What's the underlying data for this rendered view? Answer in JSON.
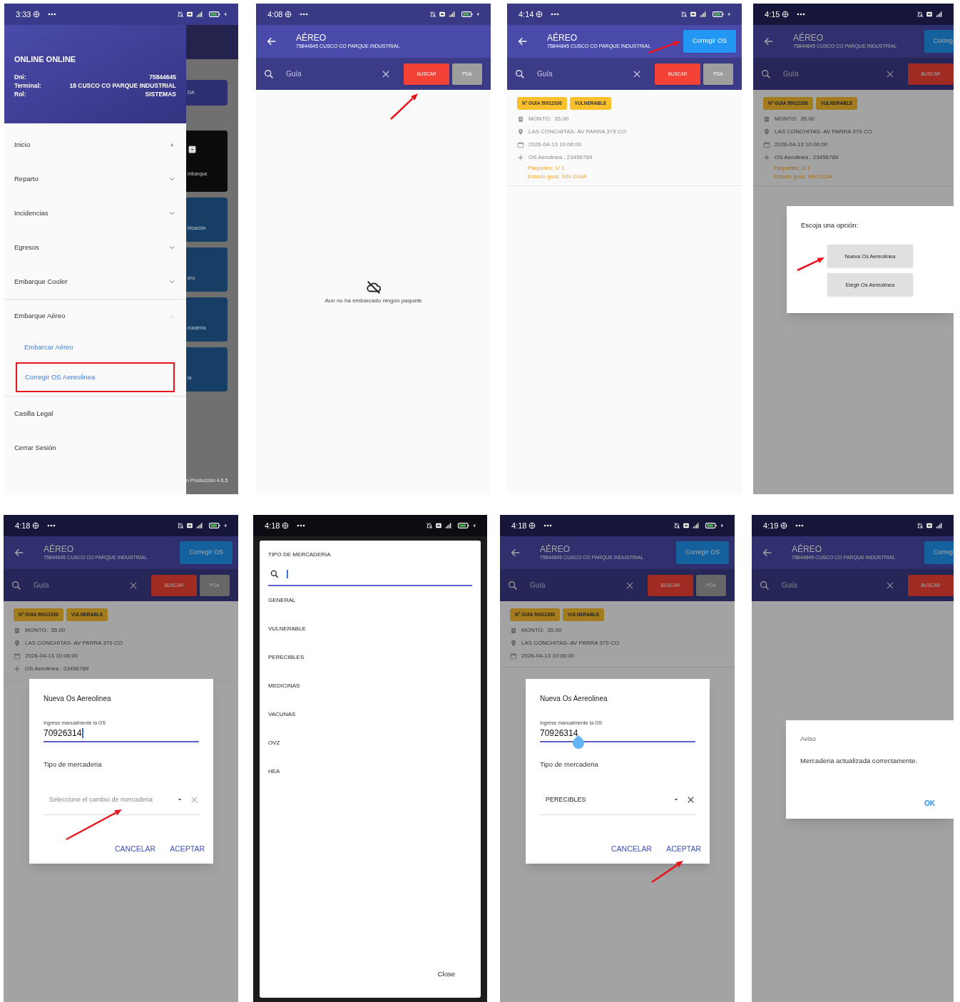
{
  "screens": [
    {
      "kind": "drawer",
      "time": "3:33",
      "profile": {
        "name": "ONLINE ONLINE",
        "fields": [
          {
            "label": "Dni:",
            "value": "75844645"
          },
          {
            "label": "Terminal:",
            "value": "18 CUSCO CO PARQUE INDUSTRIAL"
          },
          {
            "label": "Rol:",
            "value": "SISTEMAS"
          }
        ]
      },
      "menu": [
        {
          "label": "Inicio",
          "kind": "link"
        },
        {
          "label": "Reparto",
          "kind": "group",
          "expanded": false
        },
        {
          "label": "Incidencias",
          "kind": "group",
          "expanded": false
        },
        {
          "label": "Egresos",
          "kind": "group",
          "expanded": false
        },
        {
          "label": "Embarque Cooler",
          "kind": "group",
          "expanded": false
        },
        {
          "label": "Embarque Aéreo",
          "kind": "group",
          "expanded": true,
          "children": [
            {
              "label": "Embarcar Aéreo"
            },
            {
              "label": "Corregir OS Aereolinea",
              "highlighted": true
            }
          ]
        },
        {
          "label": "Casilla Legal",
          "kind": "plain"
        },
        {
          "label": "Cerrar Sesión",
          "kind": "plain"
        }
      ],
      "background_tiles": [
        {
          "kind": "bar",
          "label": "DA",
          "color": "#2e2f72"
        },
        {
          "kind": "icon",
          "label": "mbarque",
          "color": "#0b0b0b"
        },
        {
          "kind": "plain",
          "label": "bicación",
          "color": "#173f66"
        },
        {
          "kind": "plain",
          "label": "ero",
          "color": "#173f66"
        },
        {
          "kind": "plain",
          "label": "rcaderia",
          "color": "#173f66"
        },
        {
          "kind": "plain",
          "label": "ia",
          "color": "#173f66"
        }
      ],
      "version": "n Producción 4.6.5"
    },
    {
      "kind": "list",
      "time": "4:08",
      "header": {
        "title": "AÉREO",
        "subtitle": "75844645 CUSCO CO PARQUE INDUSTRIAL"
      },
      "search": {
        "placeholder": "Guía",
        "buttons": [
          {
            "label": "BUSCAR",
            "kind": "primary",
            "pointer": true
          },
          {
            "label": "PDA",
            "kind": "secondary"
          }
        ]
      },
      "empty_message": "Aun no ha embarcado ningún paquete"
    },
    {
      "kind": "list",
      "time": "4:14",
      "header": {
        "title": "AÉREO",
        "subtitle": "75844645 CUSCO CO PARQUE INDUSTRIAL",
        "action": {
          "label": "Corregir OS",
          "pointer": true
        }
      },
      "search": {
        "placeholder": "Guía",
        "buttons": [
          {
            "label": "BUSCAR",
            "kind": "primary"
          },
          {
            "label": "PDA",
            "kind": "secondary"
          }
        ]
      },
      "guide": {
        "chips": [
          "N° GUIA 50012336",
          "VULNERABLE"
        ],
        "lines": [
          {
            "kind": "amount",
            "text": "MONTO:  35.00"
          },
          {
            "kind": "address",
            "text": "LAS CONCHITAS- AV PARRA 379 CO"
          },
          {
            "kind": "date",
            "text": "2026-04-13 10:06:00"
          },
          {
            "kind": "flight",
            "text": "OS Aerolinea : 23456789"
          }
        ],
        "statuses": [
          "Paquetes: 1/ 1",
          "Estado guía: SIN GUIA"
        ]
      }
    },
    {
      "kind": "list",
      "time": "4:15",
      "cropped": true,
      "dimmed": true,
      "header": {
        "title": "AÉREO",
        "subtitle": "75844645 CUSCO CO PARQUE INDUSTRIAL",
        "action": {
          "label": "Correg"
        }
      },
      "search": {
        "placeholder": "Guía",
        "buttons": [
          {
            "label": "BUSCAR",
            "kind": "primary"
          }
        ]
      },
      "guide": {
        "chips": [
          "N° GUIA 50012336",
          "VULNERABLE"
        ],
        "lines": [
          {
            "kind": "amount",
            "text": "MONTO:  35.00"
          },
          {
            "kind": "address",
            "text": "LAS CONCHITAS- AV PARRA 379 CO"
          },
          {
            "kind": "date",
            "text": "2026-04-13 10:06:00"
          },
          {
            "kind": "flight",
            "text": "OS Aerolinea : 23456789"
          }
        ],
        "statuses": [
          "Paquetes: 1/ 1",
          "Estado guía: SIN GUIA"
        ]
      },
      "dialog": {
        "kind": "options",
        "title": "Escoja una opción:",
        "buttons": [
          {
            "label": "Nueva Os Aereolinea",
            "pointer": true
          },
          {
            "label": "Elegir Os Aereolinea"
          }
        ]
      }
    },
    {
      "kind": "list",
      "time": "4:18",
      "dimmed": true,
      "header": {
        "title": "AÉREO",
        "subtitle": "75844645 CUSCO CO PARQUE INDUSTRIAL",
        "action": {
          "label": "Corregir OS"
        }
      },
      "search": {
        "placeholder": "Guía",
        "buttons": [
          {
            "label": "BUSCAR",
            "kind": "primary"
          },
          {
            "label": "PDA",
            "kind": "secondary"
          }
        ]
      },
      "guide": {
        "chips": [
          "N° GUIA 50012336",
          "VULNERABLE"
        ],
        "lines": [
          {
            "kind": "amount",
            "text": "MONTO:  35.00"
          },
          {
            "kind": "address",
            "text": "LAS CONCHITAS- AV PARRA 379 CO"
          },
          {
            "kind": "date",
            "text": "2026-04-13 10:06:00"
          },
          {
            "kind": "flight",
            "text": "OS Aerolinea : 23456789"
          }
        ]
      },
      "dialog": {
        "kind": "new_os",
        "title": "Nueva Os Aereolinea",
        "field": {
          "label": "Ingrese manualmente la OS",
          "value": "70926314",
          "caret": true
        },
        "section_label": "Tipo de mercaderia",
        "select": {
          "placeholder": "Seleccione el cambio de mercaderia",
          "pointer": true
        },
        "actions": [
          {
            "label": "CANCELAR"
          },
          {
            "label": "ACEPTAR"
          }
        ]
      }
    },
    {
      "kind": "picker",
      "time": "4:18",
      "title": "TIPO DE MERCADERIA",
      "options": [
        "GENERAL",
        "VULNERABLE",
        "PERECIBLES",
        "MEDICINAS",
        "VACUNAS",
        "OVZ",
        "HEA"
      ],
      "close": "Close"
    },
    {
      "kind": "list",
      "time": "4:18",
      "dimmed": true,
      "header": {
        "title": "AÉREO",
        "subtitle": "75844645 CUSCO CO PARQUE INDUSTRIAL",
        "action": {
          "label": "Corregir OS"
        }
      },
      "search": {
        "placeholder": "Guía",
        "buttons": [
          {
            "label": "BUSCAR",
            "kind": "primary"
          },
          {
            "label": "PDA",
            "kind": "secondary"
          }
        ]
      },
      "guide": {
        "chips": [
          "N° GUIA 50012336",
          "VULNERABLE"
        ],
        "lines": [
          {
            "kind": "amount",
            "text": "MONTO:  35.00"
          },
          {
            "kind": "address",
            "text": "LAS CONCHITAS- AV PARRA 379 CO"
          },
          {
            "kind": "date",
            "text": "2026-04-13 10:06:00"
          }
        ]
      },
      "dialog": {
        "kind": "new_os",
        "title": "Nueva Os Aereolinea",
        "field": {
          "label": "Ingrese manualmente la OS",
          "value": "70926314",
          "handle": true
        },
        "section_label": "Tipo de mercaderia",
        "select": {
          "value": "PERECIBLES"
        },
        "actions": [
          {
            "label": "CANCELAR"
          },
          {
            "label": "ACEPTAR",
            "pointer": true
          }
        ]
      }
    },
    {
      "kind": "list",
      "time": "4:19",
      "cropped": true,
      "dimmed": true,
      "header": {
        "title": "AÉREO",
        "subtitle": "75844645 CUSCO CO PARQUE INDUSTRIAL",
        "action": {
          "label": "Correg"
        }
      },
      "search": {
        "placeholder": "Guía",
        "buttons": [
          {
            "label": "BUSCAR",
            "kind": "primary"
          }
        ]
      },
      "dialog": {
        "kind": "alert",
        "title": "Aviso",
        "message": "Mercaderia actualizada correctamente.",
        "button": "OK"
      }
    }
  ]
}
